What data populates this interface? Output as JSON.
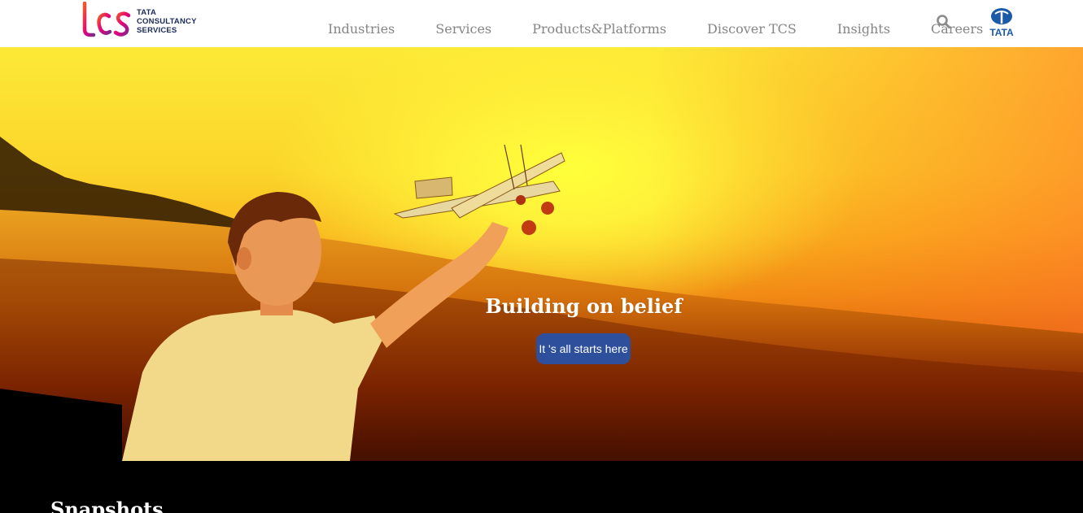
{
  "header": {
    "logo": {
      "wordmark": "tcs",
      "line1": "TATA",
      "line2": "CONSULTANCY",
      "line3": "SERVICES"
    },
    "nav": [
      {
        "label": "Industries"
      },
      {
        "label": "Services"
      },
      {
        "label": "Products&Platforms"
      },
      {
        "label": "Discover TCS"
      },
      {
        "label": "Insights"
      },
      {
        "label": "Careers"
      }
    ],
    "search_icon": "search-icon",
    "brand_logo": {
      "text": "TATA"
    }
  },
  "hero": {
    "title": "Building on belief",
    "button_label": "It 's all starts here",
    "button_color": "#2d4f9c"
  },
  "snapshots": {
    "title": "Snapshots"
  },
  "colors": {
    "header_bg": "#ffffff",
    "nav_text": "#858585",
    "page_bg": "#000000",
    "tata_blue": "#1b5aa7"
  }
}
